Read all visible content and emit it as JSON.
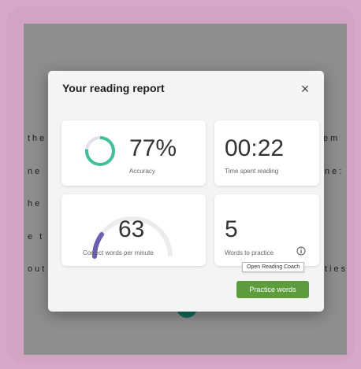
{
  "background": {
    "text_fragments": [
      "the",
      "em",
      "ne",
      "ne:",
      "he",
      "e t",
      "out",
      "ties"
    ]
  },
  "dialog": {
    "title": "Your reading report",
    "close_label": "×",
    "accuracy": {
      "value": "77%",
      "label": "Accuracy",
      "fraction": 0.77,
      "ring_color": "#3fbf9a"
    },
    "time": {
      "value": "00:22",
      "label": "Time spent reading"
    },
    "wpm": {
      "value": "63",
      "label": "Correct words per minute",
      "gauge_color": "#6b5fb0"
    },
    "words": {
      "value": "5",
      "label": "Words to practice",
      "info_icon": "info-icon"
    },
    "tooltip": "Open Reading Coach",
    "practice_button": "Practice words"
  },
  "colors": {
    "accent_green": "#5c9c3c",
    "accuracy_ring": "#3fbf9a",
    "wpm_gauge": "#6b5fb0"
  }
}
